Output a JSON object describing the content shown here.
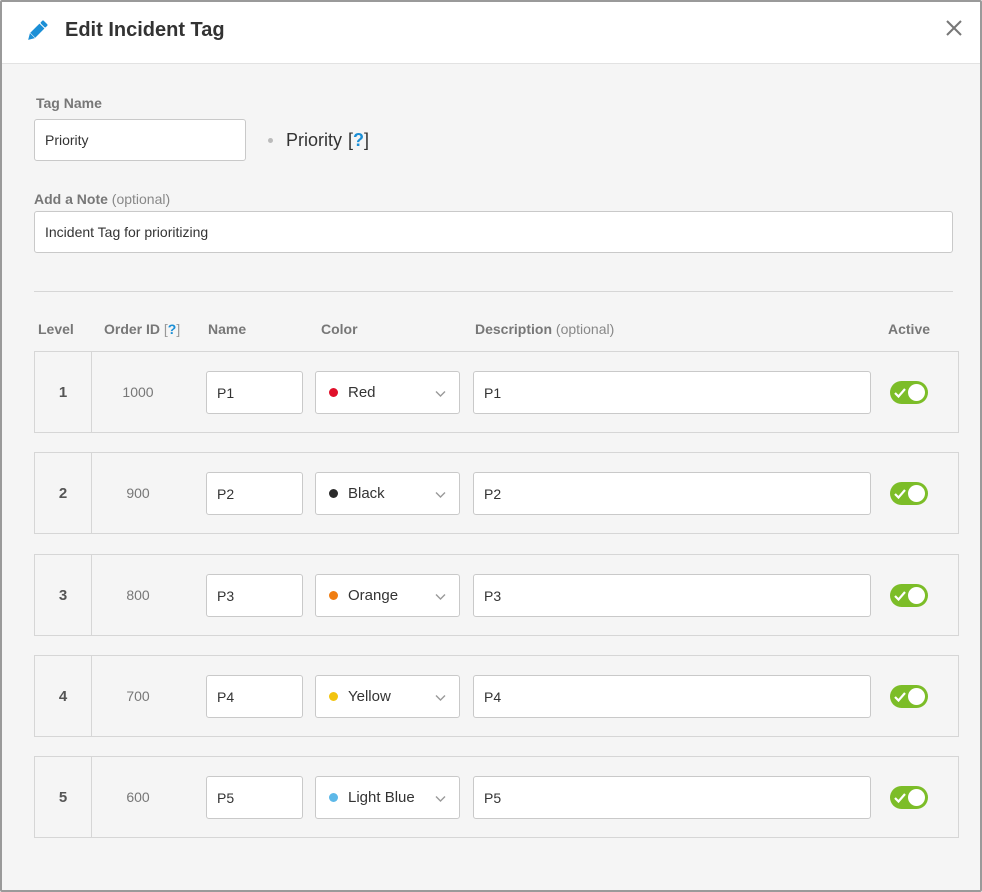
{
  "header": {
    "title": "Edit Incident Tag"
  },
  "tag_name": {
    "label": "Tag Name",
    "value": "Priority"
  },
  "preview": {
    "text": "Priority",
    "help_open": "[",
    "help_q": "?",
    "help_close": "]"
  },
  "note": {
    "label": "Add a Note",
    "optional": "(optional)",
    "value": "Incident Tag for prioritizing"
  },
  "columns": {
    "level": "Level",
    "order_id": "Order ID",
    "order_help_open": "[",
    "order_help_q": "?",
    "order_help_close": "]",
    "name": "Name",
    "color": "Color",
    "description": "Description",
    "description_optional": "(optional)",
    "active": "Active"
  },
  "rows": [
    {
      "level": "1",
      "order_id": "1000",
      "name": "P1",
      "color_label": "Red",
      "color_hex": "#e0102a",
      "description": "P1",
      "active": true
    },
    {
      "level": "2",
      "order_id": "900",
      "name": "P2",
      "color_label": "Black",
      "color_hex": "#2b2b2b",
      "description": "P2",
      "active": true
    },
    {
      "level": "3",
      "order_id": "800",
      "name": "P3",
      "color_label": "Orange",
      "color_hex": "#f07d12",
      "description": "P3",
      "active": true
    },
    {
      "level": "4",
      "order_id": "700",
      "name": "P4",
      "color_label": "Yellow",
      "color_hex": "#f2c40f",
      "description": "P4",
      "active": true
    },
    {
      "level": "5",
      "order_id": "600",
      "name": "P5",
      "color_label": "Light Blue",
      "color_hex": "#5db8e8",
      "description": "P5",
      "active": true
    }
  ],
  "colors": {
    "accent": "#1b8fd6",
    "toggle_on": "#7cbd28"
  },
  "icons": {
    "title": "pencil-icon",
    "close": "close-icon",
    "dropdown": "chevron-down-icon",
    "toggle": "check-icon"
  }
}
